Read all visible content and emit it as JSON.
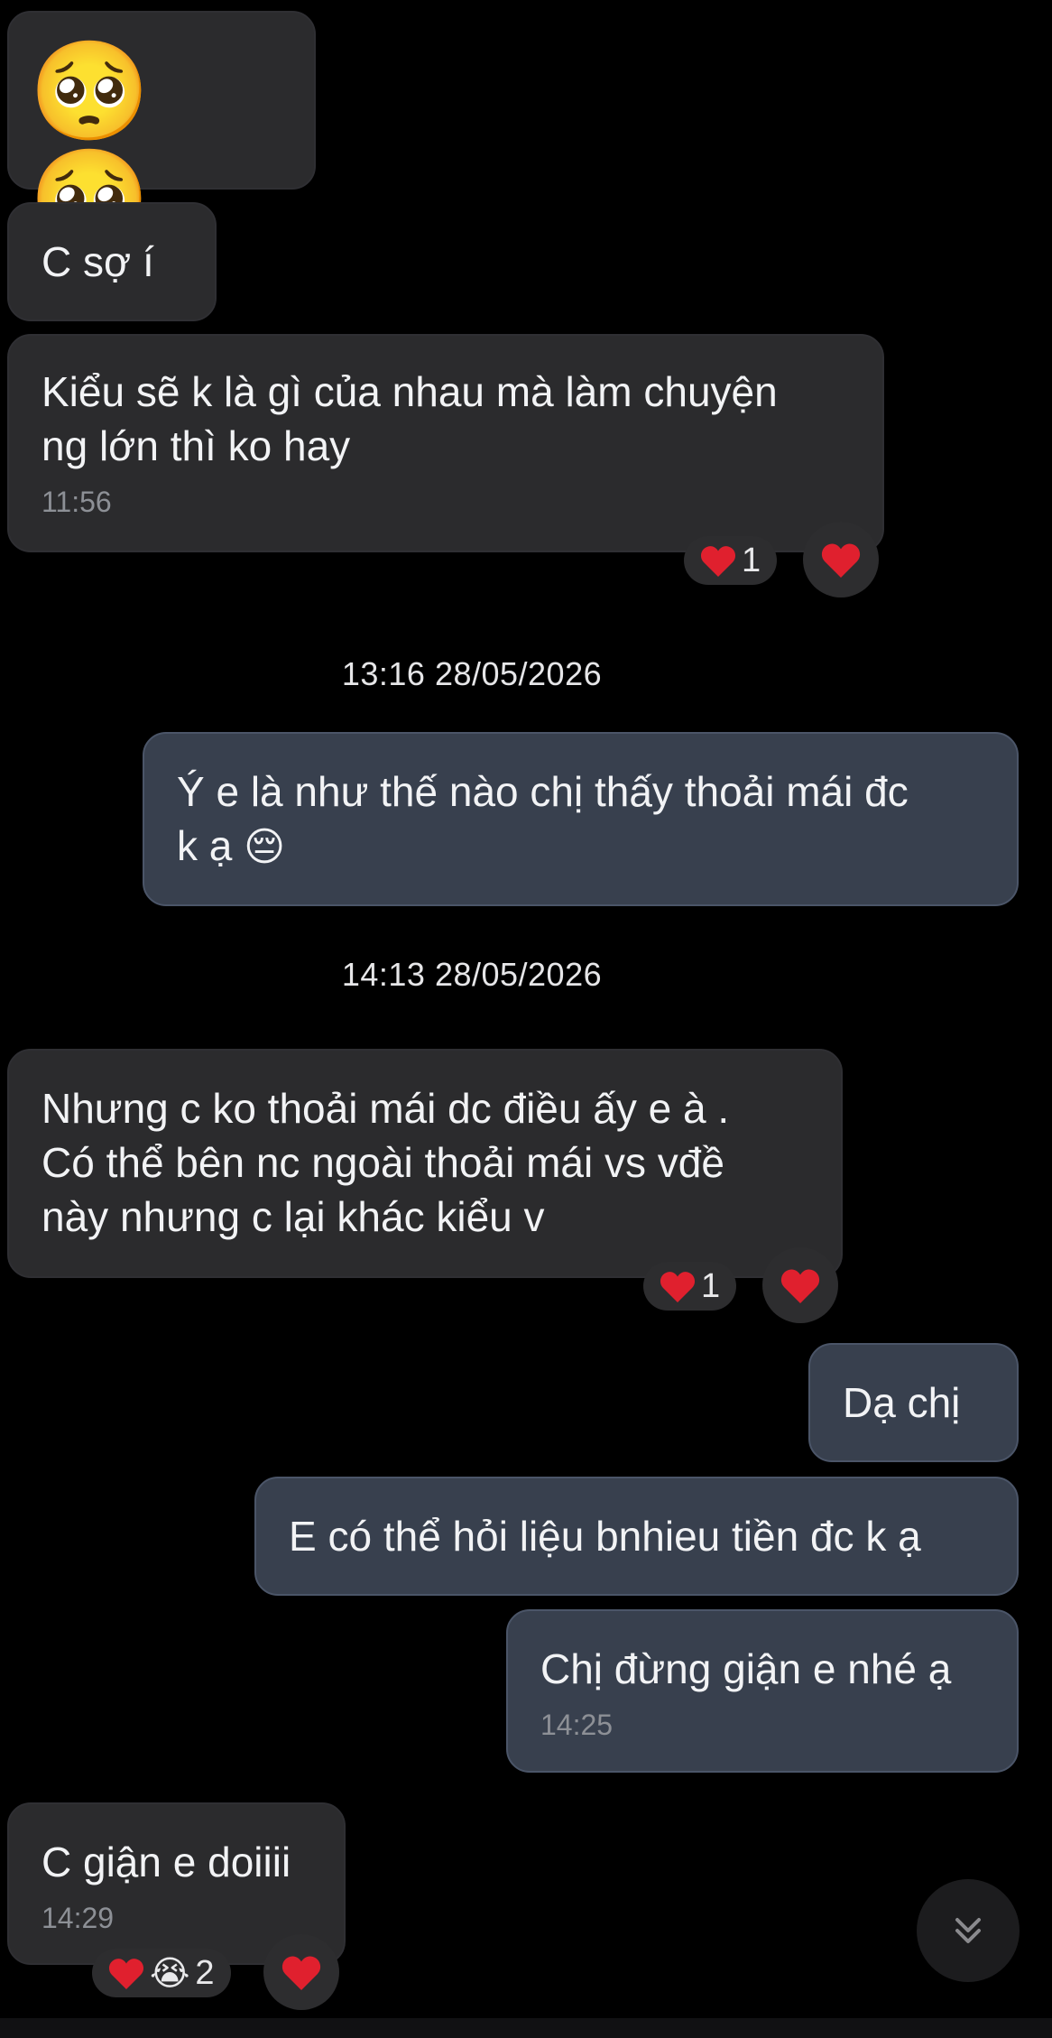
{
  "messages": [
    {
      "id": "m1",
      "direction": "incoming",
      "emoji_only": true,
      "emojis": [
        "🥺",
        "🥺"
      ]
    },
    {
      "id": "m2",
      "direction": "incoming",
      "text": "C sợ í"
    },
    {
      "id": "m3",
      "direction": "incoming",
      "text": "Kiểu sẽ k là gì của nhau mà làm chuyện\nng lớn thì ko hay",
      "time": "11:56",
      "reactions": {
        "summary_count": "1"
      }
    },
    {
      "id": "m4",
      "direction": "outgoing",
      "text": "Ý e là như thế nào chị thấy thoải mái đc\nk ạ",
      "trailing_emoji": "😔"
    },
    {
      "id": "m5",
      "direction": "incoming",
      "text": "Nhưng c ko thoải mái dc điều ấy e à .\nCó thể bên nc ngoài thoải mái vs vđề\nnày nhưng c lại khác kiểu v",
      "reactions": {
        "summary_count": "1"
      }
    },
    {
      "id": "m6",
      "direction": "outgoing",
      "text": "Dạ chị"
    },
    {
      "id": "m7",
      "direction": "outgoing",
      "text": "E có thể hỏi liệu bnhieu tiền đc k ạ"
    },
    {
      "id": "m8",
      "direction": "outgoing",
      "text": "Chị đừng giận e nhé ạ",
      "time": "14:25"
    },
    {
      "id": "m9",
      "direction": "incoming",
      "text": "C giận e doiiii",
      "time": "14:29",
      "reactions": {
        "summary_count": "2",
        "extra_emoji": "😭"
      }
    }
  ],
  "date_separators": [
    "13:16 28/05/2026",
    "14:13 28/05/2026"
  ],
  "icons": {
    "heart": "heart-icon",
    "scroll_down": "chevrons-down-icon"
  },
  "colors": {
    "background": "#000000",
    "incoming_bubble": "#2b2b2d",
    "outgoing_bubble": "#38404e",
    "heart": "#e0202e"
  }
}
